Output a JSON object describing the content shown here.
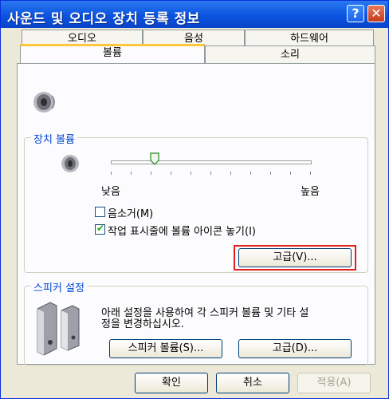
{
  "window": {
    "title": "사운드 및 오디오 장치 등록 정보",
    "help_label": "?",
    "close_label": "✕"
  },
  "tabs": {
    "row1": [
      "오디오",
      "음성",
      "하드웨어"
    ],
    "row2": [
      "볼륨",
      "소리"
    ],
    "active": "볼륨"
  },
  "device_volume": {
    "group_label": "장치 볼륨",
    "low_label": "낮음",
    "high_label": "높음",
    "mute_label": "음소거(M)",
    "mute_checked": false,
    "taskbar_label": "작업 표시줄에 볼륨 아이콘 놓기(I)",
    "taskbar_checked": true,
    "advanced_button": "고급(V)...",
    "volume_level": 0.22
  },
  "speaker_settings": {
    "group_label": "스피커 설정",
    "description_line1": "아래 설정을 사용하여 각 스피커 볼륨 및 기타 설",
    "description_line2": "정을 변경하십시오.",
    "speaker_volume_button": "스피커 볼륨(S)...",
    "advanced_button": "고급(D)..."
  },
  "footer": {
    "ok_button": "확인",
    "cancel_button": "취소",
    "apply_button": "적용(A)"
  },
  "colors": {
    "title_bar": "#0a54e0",
    "highlight": "#e0201b",
    "check": "#21a121"
  }
}
